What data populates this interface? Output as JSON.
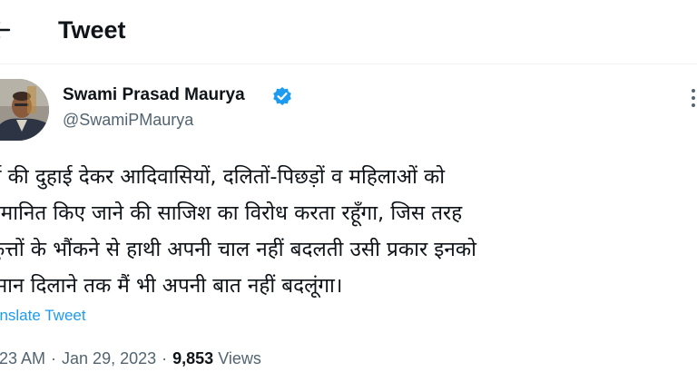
{
  "header": {
    "title": "Tweet",
    "back_icon": "arrow-left-icon"
  },
  "tweet": {
    "author": {
      "name": "Swami Prasad Maurya",
      "handle": "@SwamiPMaurya",
      "verified_icon": "verified-badge-icon",
      "verified_color": "#1d9bf0"
    },
    "text_lines": [
      "र्म की दुहाई देकर आदिवासियों, दलितों-पिछड़ों व महिलाओं को",
      "पमानित किए जाने की साजिश का विरोध करता रहूँगा, जिस तरह",
      "कुत्तों के भौंकने से हाथी अपनी चाल नहीं बदलती उसी प्रकार इनको",
      "म्मान दिलाने तक मैं भी अपनी बात नहीं बदलूंगा।"
    ],
    "translate_label": "anslate Tweet",
    "time": ":23 AM",
    "date": "Jan 29, 2023",
    "separator": "·",
    "views_count": "9,853",
    "views_label": "Views"
  },
  "colors": {
    "text": "#0f1419",
    "secondary": "#536471",
    "link": "#1d9bf0",
    "divider": "#eff3f4"
  }
}
